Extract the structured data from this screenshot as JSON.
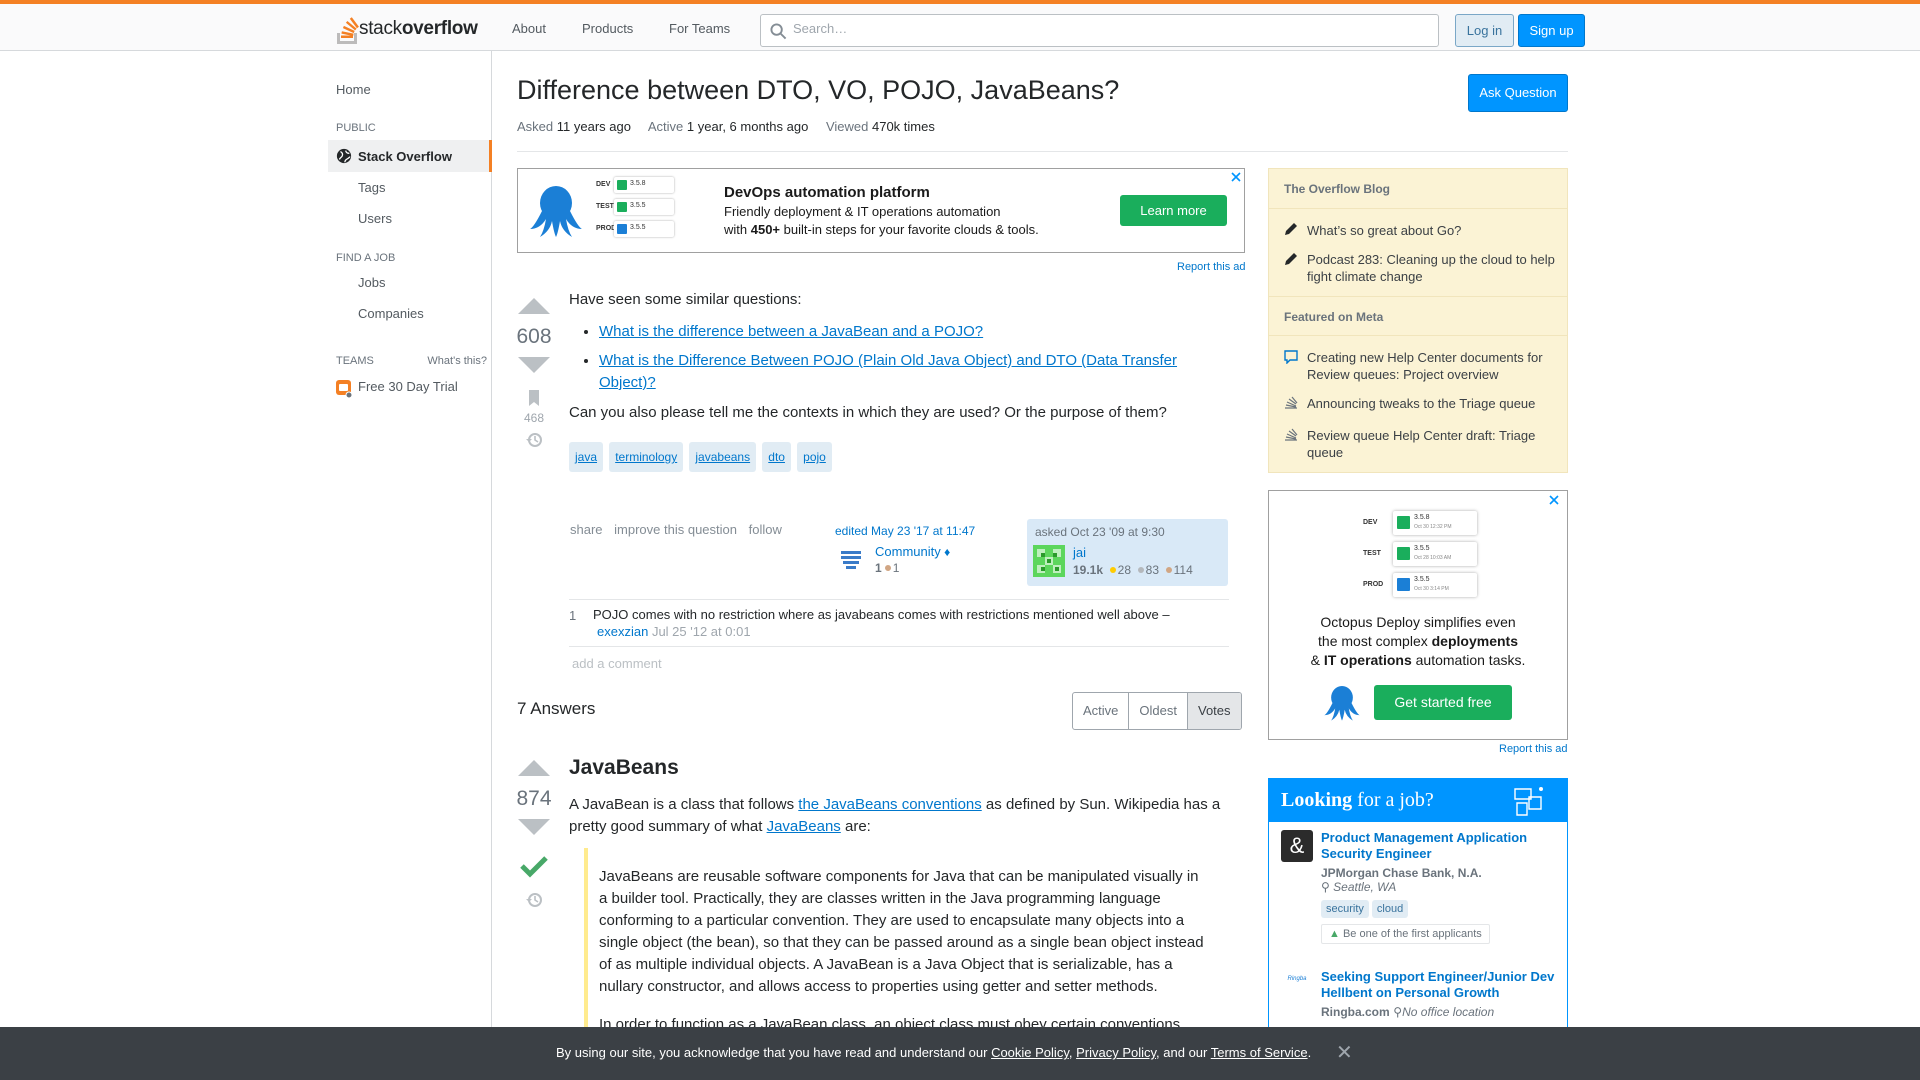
{
  "header": {
    "logo_plain": "stack",
    "logo_bold": "overflow",
    "nav": [
      "About",
      "Products",
      "For Teams"
    ],
    "search_placeholder": "Search…",
    "login": "Log in",
    "signup": "Sign up"
  },
  "sidebar": {
    "home": "Home",
    "public_heading": "PUBLIC",
    "active": "Stack Overflow",
    "tags": "Tags",
    "users": "Users",
    "find_job_heading": "FIND A JOB",
    "jobs": "Jobs",
    "companies": "Companies",
    "teams_heading": "TEAMS",
    "whats_this": "What's this?",
    "free_trial": "Free 30 Day Trial"
  },
  "question": {
    "title": "Difference between DTO, VO, POJO, JavaBeans?",
    "ask_button": "Ask Question",
    "asked_label": "Asked",
    "asked_value": "11 years ago",
    "active_label": "Active",
    "active_value": "1 year, 6 months ago",
    "viewed_label": "Viewed",
    "viewed_value": "470k times",
    "votes": "608",
    "bookmarks": "468",
    "intro": "Have seen some similar questions:",
    "links": [
      "What is the difference between a JavaBean and a POJO?",
      "What is the Difference Between POJO (Plain Old Java Object) and DTO (Data Transfer Object)?"
    ],
    "body": "Can you also please tell me the contexts in which they are used? Or the purpose of them?",
    "tags": [
      "java",
      "terminology",
      "javabeans",
      "dto",
      "pojo"
    ],
    "menu": [
      "share",
      "improve this question",
      "follow"
    ],
    "edited": "edited May 23 '17 at 11:47",
    "editor_name": "Community",
    "editor_diamond": "♦",
    "editor_rep": "1",
    "editor_bronze": "1",
    "asked_text": "asked Oct 23 '09 at 9:30",
    "asker_name": "jai",
    "asker_rep": "19.1k",
    "asker_gold": "28",
    "asker_silver": "83",
    "asker_bronze": "114"
  },
  "comment": {
    "score": "1",
    "text": "POJO comes with no restriction where as javabeans comes with restrictions mentioned well above –",
    "author": "exexzian",
    "date": "Jul 25 '12 at 0:01",
    "add": "add a comment"
  },
  "answers": {
    "count_heading": "7 Answers",
    "sort": [
      "Active",
      "Oldest",
      "Votes"
    ],
    "first": {
      "votes": "874",
      "heading": "JavaBeans",
      "intro_a": "A JavaBean is a class that follows ",
      "link1": "the JavaBeans conventions",
      "intro_b": " as defined by Sun. Wikipedia has a pretty good summary of what ",
      "link2": "JavaBeans",
      "intro_c": " are:",
      "quote": "JavaBeans are reusable software components for Java that can be manipulated visually in a builder tool. Practically, they are classes written in the Java programming language conforming to a particular convention. They are used to encapsulate many objects into a single object (the bean), so that they can be passed around as a single bean object instead of as multiple individual objects. A JavaBean is a Java Object that is serializable, has a nullary constructor, and allows access to properties using getter and setter methods.",
      "quote2": "In order to function as a JavaBean class, an object class must obey certain conventions"
    }
  },
  "ad_top": {
    "title": "DevOps automation platform",
    "line1": "Friendly deployment & IT operations automation",
    "line2_a": "with ",
    "line2_b": "450+",
    "line2_c": " built-in steps for your favorite clouds & tools.",
    "button": "Learn more",
    "envs": [
      {
        "env": "DEV",
        "ver": "3.5.8"
      },
      {
        "env": "TEST",
        "ver": "3.5.5"
      },
      {
        "env": "PROD",
        "ver": "3.5.5"
      }
    ],
    "report": "Report this ad"
  },
  "blog": {
    "heading": "The Overflow Blog",
    "items": [
      "What’s so great about Go?",
      "Podcast 283: Cleaning up the cloud to help fight climate change"
    ],
    "meta_heading": "Featured on Meta",
    "meta_items": [
      "Creating new Help Center documents for Review queues: Project overview",
      "Announcing tweaks to the Triage queue",
      "Review queue Help Center draft: Triage queue"
    ]
  },
  "ad_side": {
    "envs": [
      {
        "env": "DEV",
        "ver": "3.5.8",
        "date": "Oct 30 12:32 PM"
      },
      {
        "env": "TEST",
        "ver": "3.5.5",
        "date": "Oct 28 10:03 AM"
      },
      {
        "env": "PROD",
        "ver": "3.5.5",
        "date": "Oct 30 3:14 PM"
      }
    ],
    "line1": "Octopus Deploy simplifies even",
    "line2": "the most complex ",
    "line2_bold": "deployments",
    "line3_a": "& ",
    "line3_bold": "IT operations",
    "line3_b": " automation tasks.",
    "button": "Get started free",
    "report": "Report this ad"
  },
  "jobs": {
    "heading_bold": "Looking",
    "heading_rest": " for a job?",
    "items": [
      {
        "title": "Product Management Application Security Engineer",
        "company": "JPMorgan Chase Bank, N.A.",
        "location": "Seattle, WA",
        "tags": [
          "security",
          "cloud"
        ],
        "note": "Be one of the first applicants",
        "logo": "&"
      },
      {
        "title": "Seeking Support Engineer/Junior Dev Hellbent on Personal Growth",
        "company": "Ringba.com",
        "location": "No office location",
        "logo": "Ringba"
      }
    ]
  },
  "cookie": {
    "pre": "By using our site, you acknowledge that you have read and understand our ",
    "cookie_policy": "Cookie Policy",
    "sep1": ", ",
    "privacy": "Privacy Policy",
    "sep2": ", and our ",
    "terms": "Terms of Service",
    "end": ".",
    "close": "✕"
  },
  "colors": {
    "accent": "#f48024",
    "link": "#0077cc",
    "primary_button": "#0095ff",
    "accepted": "#48a868",
    "blog_bg": "#fbf3d5"
  }
}
